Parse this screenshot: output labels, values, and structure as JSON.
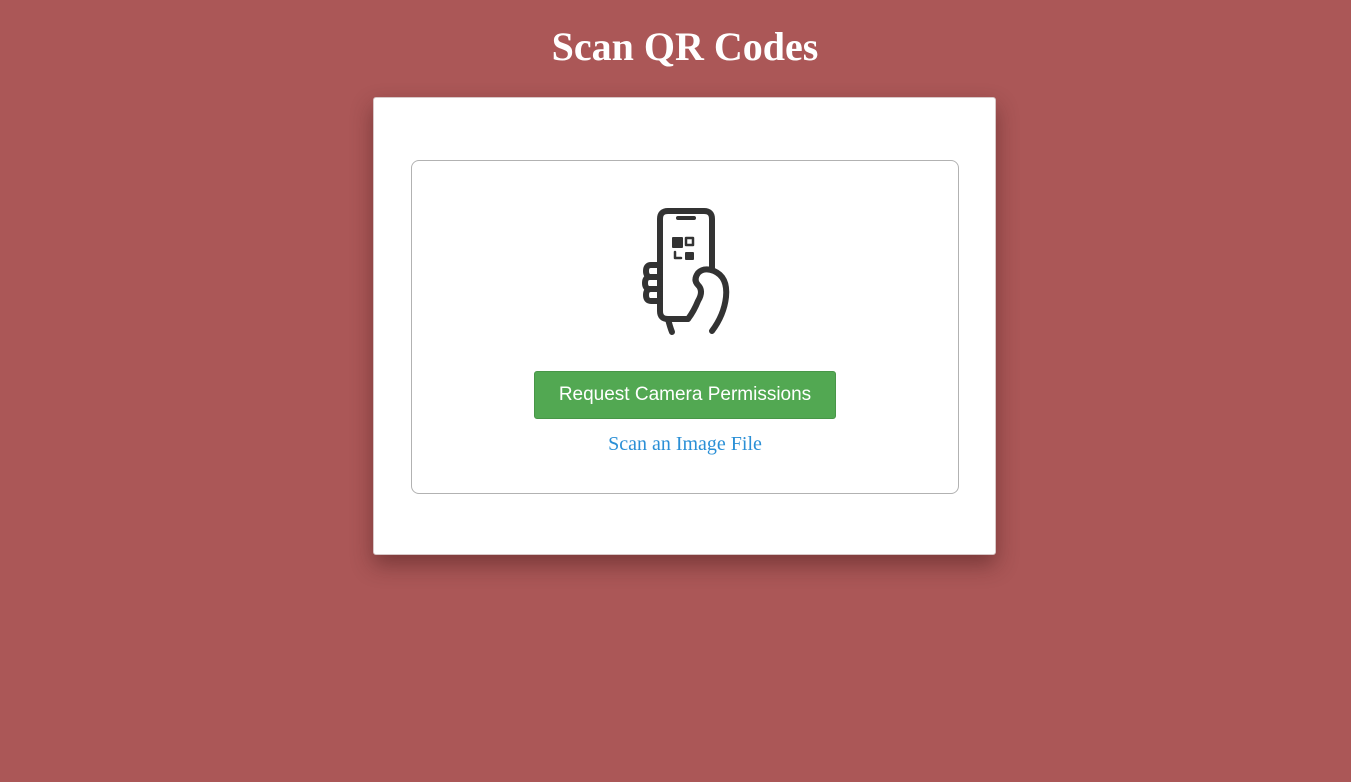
{
  "page": {
    "title": "Scan QR Codes"
  },
  "scanner": {
    "icon": "phone-qr-scan-icon",
    "request_button_label": "Request Camera Permissions",
    "file_link_label": "Scan an Image File"
  },
  "colors": {
    "background": "#ab5757",
    "card": "#ffffff",
    "button": "#52a852",
    "link": "#2a8fd6",
    "icon": "#333333"
  }
}
